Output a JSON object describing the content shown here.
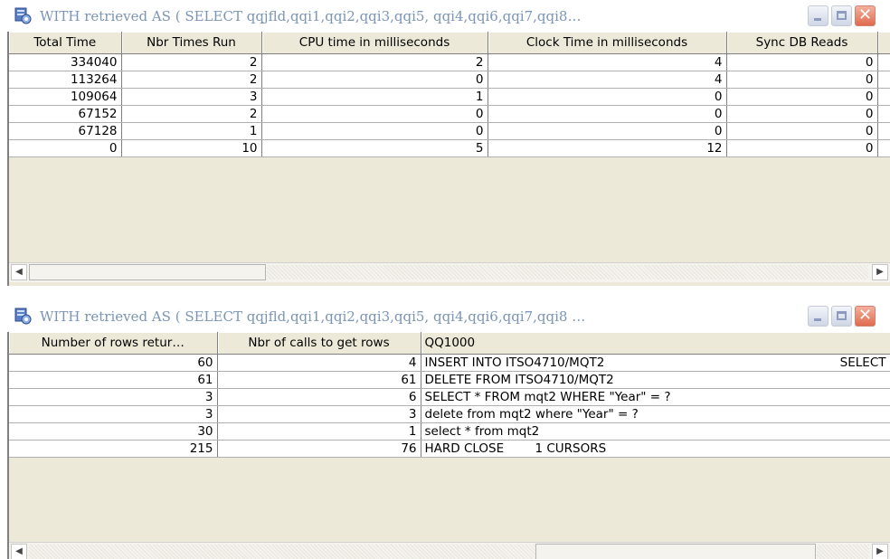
{
  "window1": {
    "title": "WITH retrieved AS (    SELECT   qqjfld,qqi1,qqi2,qqi3,qqi5, qqi4,qqi6,qqi7,qqi8…",
    "columns": [
      "Total Time",
      "Nbr Times Run",
      "CPU time in milliseconds",
      "Clock Time in milliseconds",
      "Sync DB Reads"
    ],
    "rows": [
      [
        "334040",
        "2",
        "2",
        "4",
        "0"
      ],
      [
        "113264",
        "2",
        "0",
        "4",
        "0"
      ],
      [
        "109064",
        "3",
        "1",
        "0",
        "0"
      ],
      [
        "67152",
        "2",
        "0",
        "0",
        "0"
      ],
      [
        "67128",
        "1",
        "0",
        "0",
        "0"
      ],
      [
        "0",
        "10",
        "5",
        "12",
        "0"
      ]
    ]
  },
  "window2": {
    "title": "WITH retrieved AS (    SELECT   qqjfld,qqi1,qqi2,qqi3,qqi5, qqi4,qqi6,qqi7,qqi8  …",
    "columns": [
      "Number of rows retur…",
      "Nbr of calls to get rows",
      "QQ1000"
    ],
    "rows": [
      [
        "60",
        "4",
        "INSERT INTO ITSO4710/MQT2",
        "SELECT"
      ],
      [
        "61",
        "61",
        "DELETE FROM ITSO4710/MQT2",
        ""
      ],
      [
        "3",
        "6",
        "SELECT * FROM mqt2 WHERE \"Year\" = ?",
        ""
      ],
      [
        "3",
        "3",
        "delete from mqt2 where \"Year\" = ?",
        ""
      ],
      [
        "30",
        "1",
        "select * from mqt2",
        ""
      ],
      [
        "215",
        "76",
        "HARD CLOSE        1 CURSORS",
        ""
      ]
    ]
  },
  "icons": {
    "app": "database-query-icon",
    "minimize": "minimize-icon",
    "maximize": "maximize-icon",
    "close": "close-icon",
    "scroll_left": "arrow-left-icon",
    "scroll_right": "arrow-right-icon"
  },
  "colors": {
    "title_text": "#7b95b7",
    "close_button": "#e06b4e",
    "chrome": "#ece9d8"
  }
}
